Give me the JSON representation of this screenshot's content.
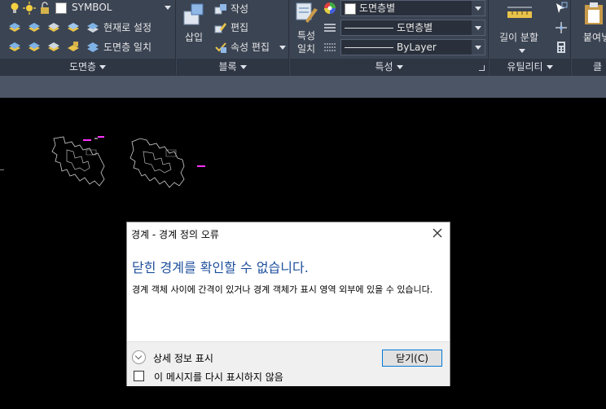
{
  "ribbon": {
    "layer_panel": {
      "layer_combo_value": "SYMBOL",
      "set_current_label": "현재로 설정",
      "match_layer_label": "도면층 일치",
      "title": "도면층"
    },
    "block_panel": {
      "insert_label": "삽입",
      "create_label": "작성",
      "edit_label": "편집",
      "edit_attributes_label": "속성 편집",
      "title": "블록"
    },
    "properties_panel": {
      "match_properties_label": "특성\n일치",
      "color_combo_value": "도면층별",
      "linetype_combo_value": "도면층별",
      "lineweight_combo_value": "ByLayer",
      "title": "특성"
    },
    "utilities_panel": {
      "measure_label": "길이 분할",
      "title": "유틸리티"
    },
    "clipboard_panel": {
      "paste_label": "붙여넣",
      "title": "클립"
    }
  },
  "dialog": {
    "title": "경계 - 경계 정의 오류",
    "heading": "닫힌 경계를 확인할 수 없습니다.",
    "message": "경계 객체 사이에 간격이 있거나 경계 객체가 표시 영역 외부에 있을 수 있습니다.",
    "details_label": "상세 정보 표시",
    "close_button_label": "닫기(C)",
    "dont_show_label": "이 메시지를 다시 표시하지 않음"
  },
  "colors": {
    "ribbon_bg": "#3b4453",
    "canvas_bg": "#000000",
    "dialog_heading": "#1e4f9c",
    "highlight_magenta": "#ff33ff"
  }
}
